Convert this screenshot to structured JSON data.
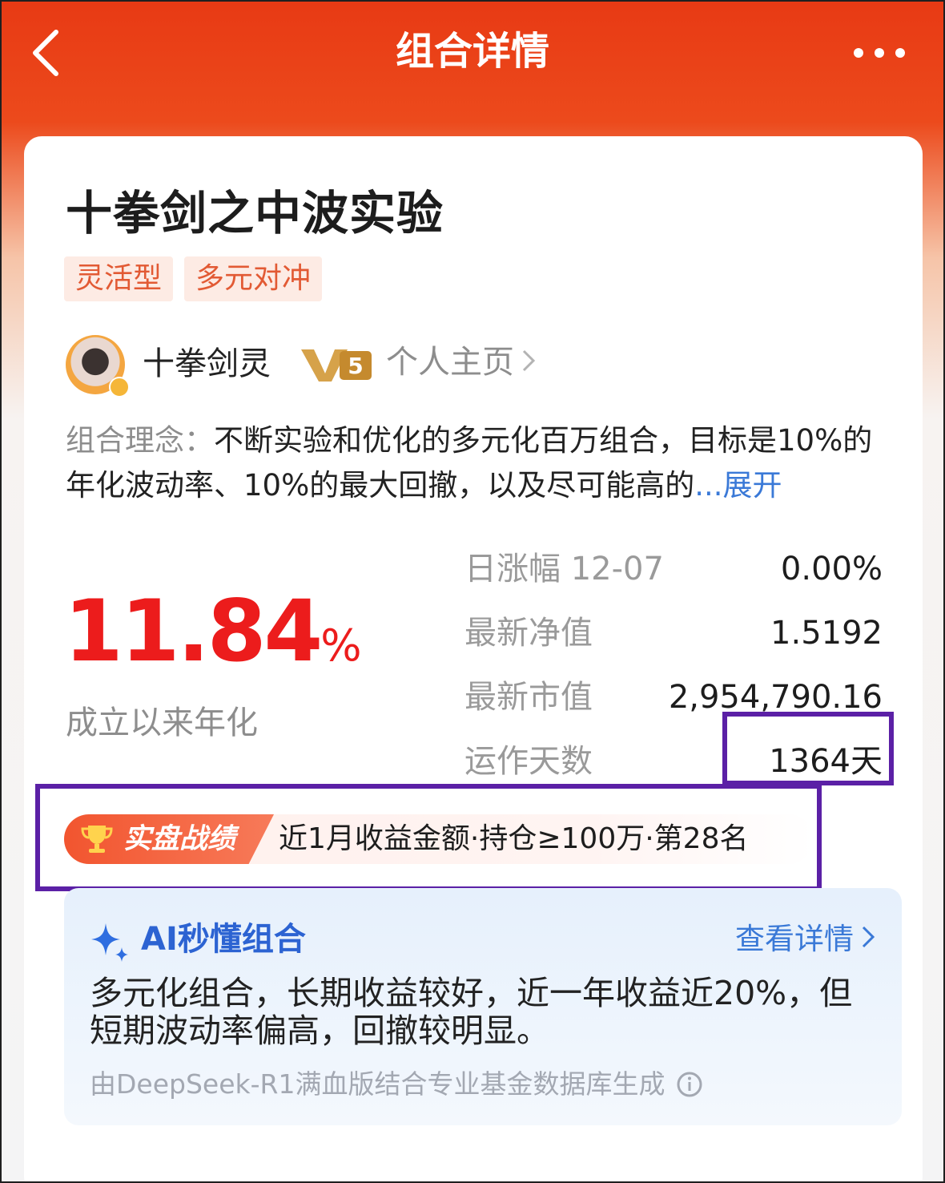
{
  "header": {
    "title": "组合详情"
  },
  "portfolio": {
    "name": "十拳剑之中波实验",
    "tags": [
      "灵活型",
      "多元对冲"
    ],
    "author": {
      "name": "十拳剑灵",
      "level": "5",
      "homepage_label": "个人主页"
    },
    "concept": {
      "label": "组合理念：",
      "text": "不断实验和优化的多元化百万组合，目标是10%的年化波动率、10%的最大回撤，以及尽可能高的",
      "ellipsis": "...",
      "expand_label": "展开"
    },
    "annualized_return": {
      "value": "11.84",
      "unit": "%",
      "label": "成立以来年化"
    },
    "stats": [
      {
        "label": "日涨幅 12-07",
        "value": "0.00%"
      },
      {
        "label": "最新净值",
        "value": "1.5192"
      },
      {
        "label": "最新市值",
        "value": "2,954,790.16"
      },
      {
        "label": "运作天数",
        "value": "1364天"
      }
    ],
    "ranking": {
      "badge": "实盘战绩",
      "text": "近1月收益金额·持仓≥100万·第28名"
    }
  },
  "ai_summary": {
    "title": "AI秒懂组合",
    "link_label": "查看详情",
    "summary": "多元化组合，长期收益较好，近一年收益近20%，但短期波动率偏高，回撤较明显。",
    "source": "由DeepSeek-R1满血版结合专业基金数据库生成"
  },
  "colors": {
    "header_bg": "#e83a14",
    "return_red": "#ec1c1c",
    "highlight_box": "#5b20a6",
    "link_blue": "#3a79d7"
  },
  "icons": [
    "chevron-left-icon",
    "more-icon",
    "level-badge-icon",
    "chevron-right-icon",
    "trophy-icon",
    "sparkle-icon",
    "info-icon"
  ]
}
